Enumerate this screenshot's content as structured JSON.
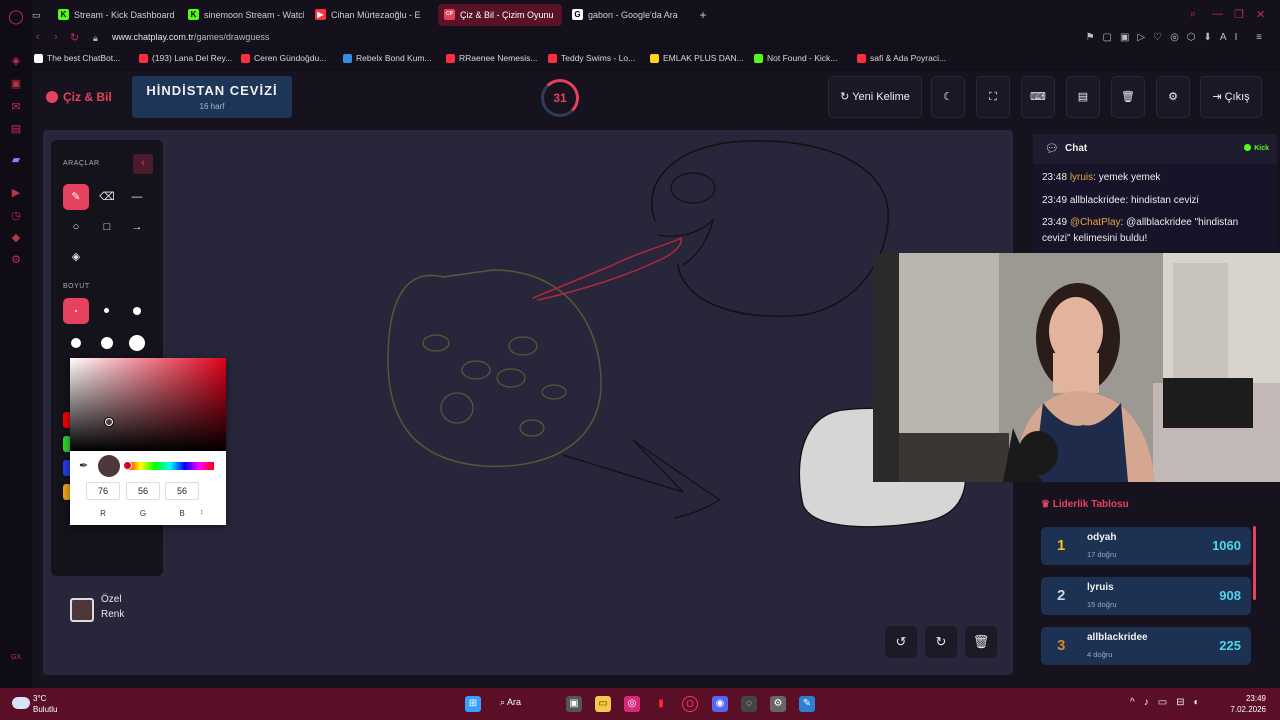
{
  "browser": {
    "tabs": [
      {
        "label": "Stream - Kick Dashboard",
        "color": "#53fc18",
        "glyph": "K"
      },
      {
        "label": "sinemoon Stream - Watch",
        "color": "#53fc18",
        "glyph": "K"
      },
      {
        "label": "Cihan Mürtezaoğlu - E",
        "color": "#ff2e3d",
        "glyph": "▶"
      },
      {
        "label": "Çiz & Bil - Çizim Oyunu",
        "color": "#e5425f",
        "glyph": "CP"
      },
      {
        "label": "gabon - Google'da Ara",
        "color": "#ffffff",
        "glyph": "G"
      }
    ],
    "url_host": "www.chatplay.com.tr",
    "url_path": "/games/drawguess",
    "ai_label": "AI",
    "bookmarks": [
      {
        "label": "The best ChatBot...",
        "color": "#ffffff"
      },
      {
        "label": "(193) Lana Del Rey...",
        "color": "#ff2e3d"
      },
      {
        "label": "Ceren Gündoğdu...",
        "color": "#ff2e3d"
      },
      {
        "label": "Rebelx Bond Kum...",
        "color": "#3a8dde"
      },
      {
        "label": "RRaenee Nemesis...",
        "color": "#ff2e3d"
      },
      {
        "label": "Teddy Swims - Lo...",
        "color": "#ff2e3d"
      },
      {
        "label": "EMLAK PLUS DAN...",
        "color": "#ffd21e"
      },
      {
        "label": "Not Found - Kick...",
        "color": "#53fc18"
      },
      {
        "label": "safi & Ada Poyraci...",
        "color": "#ff2e3d"
      }
    ]
  },
  "header": {
    "logo": "Çiz & Bil",
    "word": "HİNDİSTAN CEVİZİ",
    "word_hint": "16 harf",
    "timer": "31",
    "new_word_label": "Yeni Kelime",
    "exit_label": "Çıkış"
  },
  "toolbox": {
    "tools_heading": "ARAÇLAR",
    "size_heading": "BOYUT",
    "custom_color_label_1": "Özel",
    "custom_color_label_2": "Renk",
    "custom_color": "#4c3838"
  },
  "picker": {
    "r": "76",
    "g": "56",
    "b": "56",
    "r_label": "R",
    "g_label": "G",
    "b_label": "B",
    "toggle": "↕"
  },
  "chat": {
    "title": "Chat",
    "platform": "Kick",
    "messages": [
      {
        "time": "23:48",
        "user": "lyruis",
        "text": ": yemek yemek"
      },
      {
        "time": "23:49",
        "user": "allblackridee",
        "text": ": hindistan cevizi"
      },
      {
        "time": "23:49",
        "user": "@ChatPlay",
        "text": ": @allblackridee \"hindistan cevizi\" kelimesini buldu!"
      }
    ]
  },
  "leaderboard": {
    "title": "Liderlik Tablosu",
    "rows": [
      {
        "rank": "1",
        "name": "odyah",
        "sub": "17 doğru",
        "score": "1060",
        "color": "#f5c518"
      },
      {
        "rank": "2",
        "name": "lyruis",
        "sub": "15 doğru",
        "score": "908",
        "color": "#cfd6e0"
      },
      {
        "rank": "3",
        "name": "allblackridee",
        "sub": "4 doğru",
        "score": "225",
        "color": "#d9892a"
      }
    ]
  },
  "taskbar": {
    "temp": "3°C",
    "weather": "Bulutlu",
    "search": "Ara",
    "time": "23:49",
    "date": "7.02.2026"
  }
}
